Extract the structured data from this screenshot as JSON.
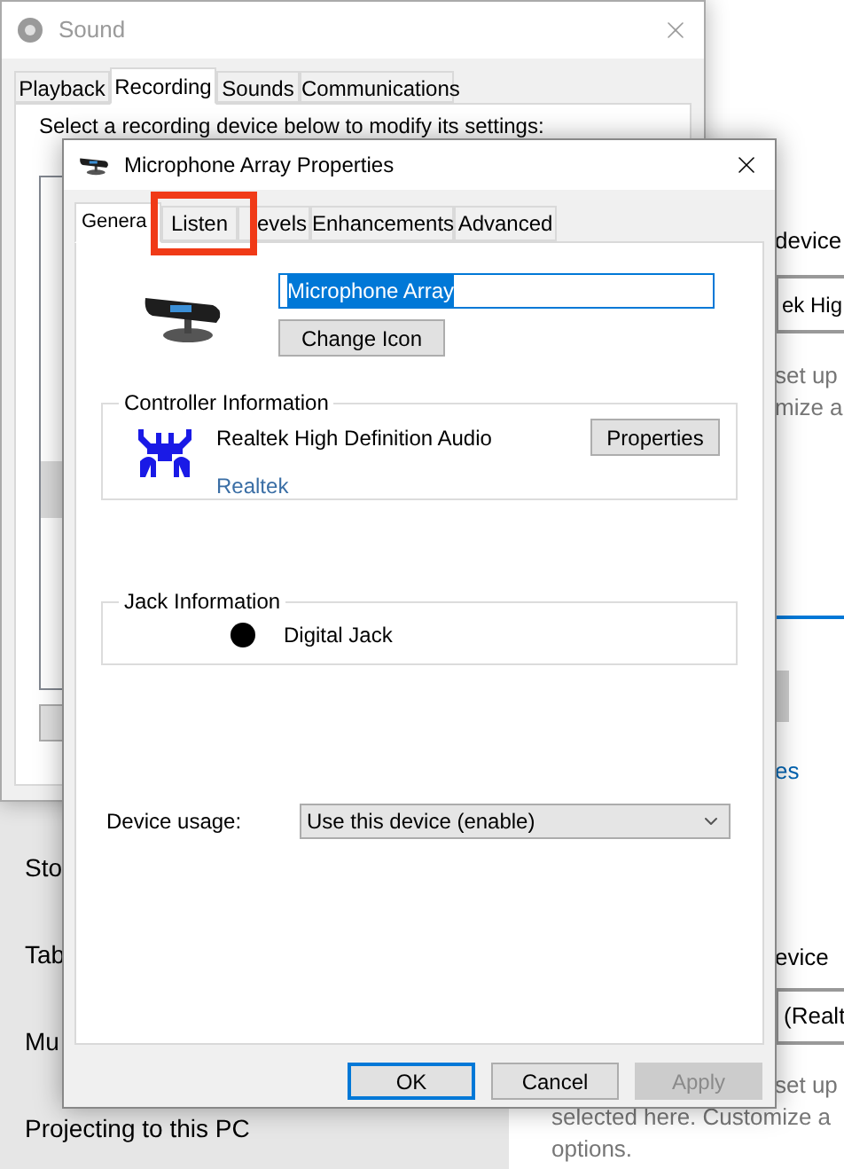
{
  "settings": {
    "nav_items": [
      "Sto",
      "Tab",
      "Mu",
      "Projecting to this PC"
    ],
    "right_top": {
      "heading": "device",
      "dropdown": "ek Hig",
      "lines": [
        "set up",
        "mize a"
      ],
      "link": "es"
    },
    "right_bottom": {
      "heading": "evice",
      "dropdown": "(Realt",
      "lines": [
        "set up",
        "selected here. Customize a",
        "options."
      ]
    }
  },
  "sound_window": {
    "title": "Sound",
    "tabs": [
      {
        "label": "Playback",
        "selected": false
      },
      {
        "label": "Recording",
        "selected": true
      },
      {
        "label": "Sounds",
        "selected": false
      },
      {
        "label": "Communications",
        "selected": false
      }
    ],
    "instruction": "Select a recording device below to modify its settings:"
  },
  "dialog": {
    "title": "Microphone Array Properties",
    "tabs": [
      {
        "label": "Genera",
        "selected": true
      },
      {
        "label": "Listen",
        "selected": false
      },
      {
        "label": "evels",
        "selected": false
      },
      {
        "label": "Enhancements",
        "selected": false
      },
      {
        "label": "Advanced",
        "selected": false
      }
    ],
    "name_field": {
      "value": "Microphone Array",
      "text_selected": true
    },
    "change_icon_button": "Change Icon",
    "controller": {
      "legend": "Controller Information",
      "name": "Realtek High Definition Audio",
      "link": "Realtek",
      "button": "Properties"
    },
    "jack": {
      "legend": "Jack Information",
      "name": "Digital Jack",
      "color": "#000000"
    },
    "device_usage": {
      "label": "Device usage:",
      "value": "Use this device (enable)"
    },
    "buttons": [
      {
        "label": "OK",
        "default": true,
        "disabled": false
      },
      {
        "label": "Cancel",
        "default": false,
        "disabled": false
      },
      {
        "label": "Apply",
        "default": false,
        "disabled": true
      }
    ]
  },
  "annotations": [
    {
      "kind": "rectangle",
      "color": "#f03a17"
    }
  ]
}
